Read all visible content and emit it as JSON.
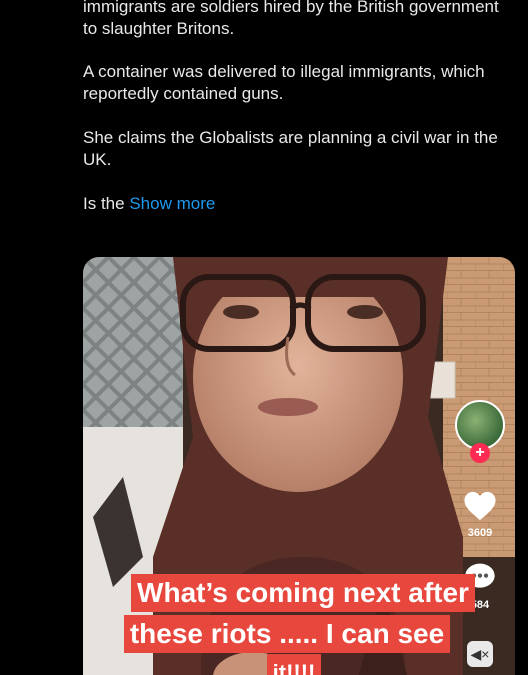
{
  "tweet": {
    "paragraphs": [
      "immigrants are soldiers hired by the British government to slaughter Britons.",
      "A container was delivered to illegal immigrants, which reportedly contained guns.",
      "She claims the Globalists are planning a civil war in the UK."
    ],
    "truncated": "Is the",
    "show_more": "Show more"
  },
  "video": {
    "likes": "3609",
    "comments": "584",
    "caption_lines": [
      "What’s coming next after",
      "these riots ..... I can see",
      "it!!!!"
    ]
  },
  "colors": {
    "link": "#1d9bf0",
    "caption_bg": "#e8473d",
    "follow": "#fe2c55"
  },
  "icons": [
    "avatar",
    "plus-icon",
    "heart-icon",
    "comment-icon",
    "sound-icon"
  ]
}
